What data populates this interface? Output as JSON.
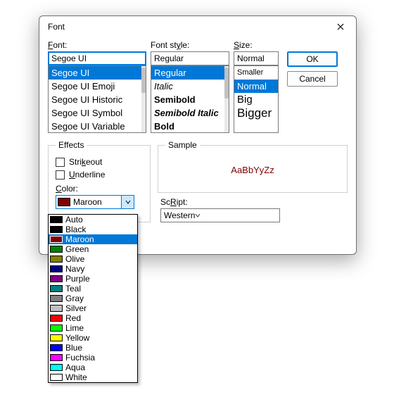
{
  "window": {
    "title": "Font"
  },
  "labels": {
    "font": "Font:",
    "font_u": "F",
    "style": "Font style:",
    "style_u": "y",
    "size": "Size:",
    "size_u": "S",
    "effects": "Effects",
    "strikeout": "Strikeout",
    "strikeout_u": "k",
    "underline": "Underline",
    "underline_u": "U",
    "color": "Color:",
    "color_u": "C",
    "sample": "Sample",
    "script": "Script:",
    "script_u": "R"
  },
  "buttons": {
    "ok": "OK",
    "cancel": "Cancel"
  },
  "font": {
    "value": "Segoe UI",
    "list": [
      "Segoe UI",
      "Segoe UI Emoji",
      "Segoe UI Historic",
      "Segoe UI Symbol",
      "Segoe UI Variable"
    ]
  },
  "style": {
    "value": "Regular",
    "list": [
      {
        "label": "Regular",
        "weight": "400",
        "italic": false
      },
      {
        "label": "Italic",
        "weight": "400",
        "italic": true
      },
      {
        "label": "Semibold",
        "weight": "600",
        "italic": false
      },
      {
        "label": "Semibold Italic",
        "weight": "600",
        "italic": true
      },
      {
        "label": "Bold",
        "weight": "700",
        "italic": false
      }
    ]
  },
  "size": {
    "value": "Normal",
    "list": [
      "Smaller",
      "Normal",
      "Big",
      "Bigger"
    ]
  },
  "effects": {
    "strikeout": false,
    "underline": false,
    "color_selected": "Maroon"
  },
  "colors": [
    {
      "name": "Auto",
      "hex": "#000000"
    },
    {
      "name": "Black",
      "hex": "#000000"
    },
    {
      "name": "Maroon",
      "hex": "#800000"
    },
    {
      "name": "Green",
      "hex": "#008000"
    },
    {
      "name": "Olive",
      "hex": "#808000"
    },
    {
      "name": "Navy",
      "hex": "#000080"
    },
    {
      "name": "Purple",
      "hex": "#800080"
    },
    {
      "name": "Teal",
      "hex": "#008080"
    },
    {
      "name": "Gray",
      "hex": "#808080"
    },
    {
      "name": "Silver",
      "hex": "#C0C0C0"
    },
    {
      "name": "Red",
      "hex": "#FF0000"
    },
    {
      "name": "Lime",
      "hex": "#00FF00"
    },
    {
      "name": "Yellow",
      "hex": "#FFFF00"
    },
    {
      "name": "Blue",
      "hex": "#0000FF"
    },
    {
      "name": "Fuchsia",
      "hex": "#FF00FF"
    },
    {
      "name": "Aqua",
      "hex": "#00FFFF"
    },
    {
      "name": "White",
      "hex": "#FFFFFF"
    }
  ],
  "sample_text": "AaBbYyZz",
  "script": {
    "value": "Western"
  }
}
